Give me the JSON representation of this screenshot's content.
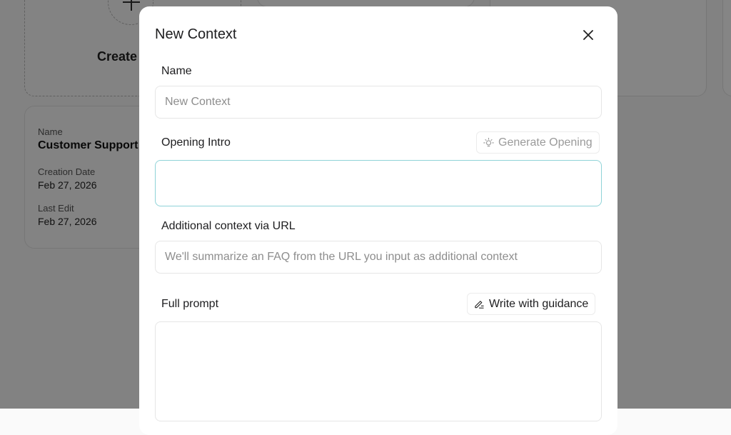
{
  "background": {
    "create_label": "Create",
    "context_card": {
      "name_label": "Name",
      "name_value": "Customer Support",
      "creation_label": "Creation Date",
      "creation_value": "Feb 27, 2026",
      "last_edit_label": "Last Edit",
      "last_edit_value": "Feb 27, 2026"
    }
  },
  "modal": {
    "title": "New Context",
    "close_icon": "close-icon",
    "name": {
      "label": "Name",
      "placeholder": "New Context",
      "value": ""
    },
    "opening_intro": {
      "label": "Opening Intro",
      "generate_label": "Generate Opening",
      "generate_icon": "lightbulb-icon",
      "value": ""
    },
    "url": {
      "label": "Additional context via URL",
      "placeholder": "We'll summarize an FAQ from the URL you input as additional context",
      "value": ""
    },
    "full_prompt": {
      "label": "Full prompt",
      "guidance_label": "Write with guidance",
      "guidance_icon": "pen-lines-icon",
      "value": ""
    }
  },
  "colors": {
    "focus_border": "#8fd3d8",
    "overlay": "rgba(0,0,0,0.48)",
    "disabled_text": "#9a9a9a"
  }
}
